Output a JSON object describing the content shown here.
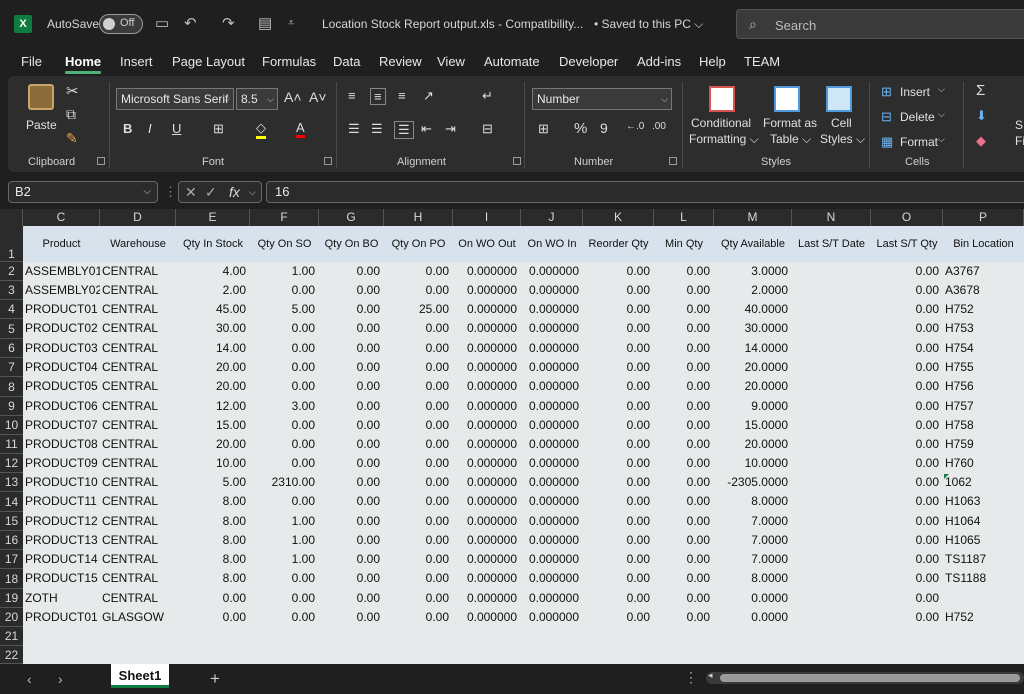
{
  "app": {
    "logo": "X",
    "autosave_label": "AutoSave",
    "autosave_state": "Off",
    "doc_title": "Location Stock Report output.xls  -  Compatibility...",
    "saved_status": "• Saved to this PC ⌵",
    "search_placeholder": "Search"
  },
  "menu": [
    "File",
    "Home",
    "Insert",
    "Page Layout",
    "Formulas",
    "Data",
    "Review",
    "View",
    "Automate",
    "Developer",
    "Add-ins",
    "Help",
    "TEAM"
  ],
  "ribbon": {
    "clipboard": {
      "label": "Clipboard",
      "paste": "Paste"
    },
    "font": {
      "label": "Font",
      "name": "Microsoft Sans Serif",
      "size": "8.5"
    },
    "alignment": {
      "label": "Alignment"
    },
    "number": {
      "label": "Number",
      "format": "Number"
    },
    "styles": {
      "label": "Styles",
      "conditional": "Conditional",
      "formatting": "Formatting ⌵",
      "format_as": "Format as",
      "table": "Table ⌵",
      "cell": "Cell",
      "styles_btn": "Styles ⌵"
    },
    "cells": {
      "label": "Cells",
      "insert": "Insert",
      "delete": "Delete",
      "format": "Format"
    },
    "editing": {
      "sort_s": "S",
      "fi": "Fi"
    }
  },
  "formula_bar": {
    "cell_ref": "B2",
    "value": "16"
  },
  "columns": [
    "C",
    "D",
    "E",
    "F",
    "G",
    "H",
    "I",
    "J",
    "K",
    "L",
    "M",
    "N",
    "O",
    "P"
  ],
  "headers": [
    "Product",
    "Warehouse",
    "Qty In Stock",
    "Qty On SO",
    "Qty On BO",
    "Qty On PO",
    "On WO Out",
    "On WO In",
    "Reorder Qty",
    "Min Qty",
    "Qty Available",
    "Last S/T Date",
    "Last S/T Qty",
    "Bin Location"
  ],
  "rows": [
    [
      "ASSEMBLY01",
      "CENTRAL",
      "4.00",
      "1.00",
      "0.00",
      "0.00",
      "0.000000",
      "0.000000",
      "0.00",
      "0.00",
      "3.0000",
      "",
      "0.00",
      "A3767"
    ],
    [
      "ASSEMBLY02",
      "CENTRAL",
      "2.00",
      "0.00",
      "0.00",
      "0.00",
      "0.000000",
      "0.000000",
      "0.00",
      "0.00",
      "2.0000",
      "",
      "0.00",
      "A3678"
    ],
    [
      "PRODUCT01",
      "CENTRAL",
      "45.00",
      "5.00",
      "0.00",
      "25.00",
      "0.000000",
      "0.000000",
      "0.00",
      "0.00",
      "40.0000",
      "",
      "0.00",
      "H752"
    ],
    [
      "PRODUCT02",
      "CENTRAL",
      "30.00",
      "0.00",
      "0.00",
      "0.00",
      "0.000000",
      "0.000000",
      "0.00",
      "0.00",
      "30.0000",
      "",
      "0.00",
      "H753"
    ],
    [
      "PRODUCT03",
      "CENTRAL",
      "14.00",
      "0.00",
      "0.00",
      "0.00",
      "0.000000",
      "0.000000",
      "0.00",
      "0.00",
      "14.0000",
      "",
      "0.00",
      "H754"
    ],
    [
      "PRODUCT04",
      "CENTRAL",
      "20.00",
      "0.00",
      "0.00",
      "0.00",
      "0.000000",
      "0.000000",
      "0.00",
      "0.00",
      "20.0000",
      "",
      "0.00",
      "H755"
    ],
    [
      "PRODUCT05",
      "CENTRAL",
      "20.00",
      "0.00",
      "0.00",
      "0.00",
      "0.000000",
      "0.000000",
      "0.00",
      "0.00",
      "20.0000",
      "",
      "0.00",
      "H756"
    ],
    [
      "PRODUCT06",
      "CENTRAL",
      "12.00",
      "3.00",
      "0.00",
      "0.00",
      "0.000000",
      "0.000000",
      "0.00",
      "0.00",
      "9.0000",
      "",
      "0.00",
      "H757"
    ],
    [
      "PRODUCT07",
      "CENTRAL",
      "15.00",
      "0.00",
      "0.00",
      "0.00",
      "0.000000",
      "0.000000",
      "0.00",
      "0.00",
      "15.0000",
      "",
      "0.00",
      "H758"
    ],
    [
      "PRODUCT08",
      "CENTRAL",
      "20.00",
      "0.00",
      "0.00",
      "0.00",
      "0.000000",
      "0.000000",
      "0.00",
      "0.00",
      "20.0000",
      "",
      "0.00",
      "H759"
    ],
    [
      "PRODUCT09",
      "CENTRAL",
      "10.00",
      "0.00",
      "0.00",
      "0.00",
      "0.000000",
      "0.000000",
      "0.00",
      "0.00",
      "10.0000",
      "",
      "0.00",
      "H760"
    ],
    [
      "PRODUCT10",
      "CENTRAL",
      "5.00",
      "2310.00",
      "0.00",
      "0.00",
      "0.000000",
      "0.000000",
      "0.00",
      "0.00",
      "-2305.0000",
      "",
      "0.00",
      "1062"
    ],
    [
      "PRODUCT11",
      "CENTRAL",
      "8.00",
      "0.00",
      "0.00",
      "0.00",
      "0.000000",
      "0.000000",
      "0.00",
      "0.00",
      "8.0000",
      "",
      "0.00",
      "H1063"
    ],
    [
      "PRODUCT12",
      "CENTRAL",
      "8.00",
      "1.00",
      "0.00",
      "0.00",
      "0.000000",
      "0.000000",
      "0.00",
      "0.00",
      "7.0000",
      "",
      "0.00",
      "H1064"
    ],
    [
      "PRODUCT13",
      "CENTRAL",
      "8.00",
      "1.00",
      "0.00",
      "0.00",
      "0.000000",
      "0.000000",
      "0.00",
      "0.00",
      "7.0000",
      "",
      "0.00",
      "H1065"
    ],
    [
      "PRODUCT14",
      "CENTRAL",
      "8.00",
      "1.00",
      "0.00",
      "0.00",
      "0.000000",
      "0.000000",
      "0.00",
      "0.00",
      "7.0000",
      "",
      "0.00",
      "TS1187"
    ],
    [
      "PRODUCT15",
      "CENTRAL",
      "8.00",
      "0.00",
      "0.00",
      "0.00",
      "0.000000",
      "0.000000",
      "0.00",
      "0.00",
      "8.0000",
      "",
      "0.00",
      "TS1188"
    ],
    [
      "ZOTH",
      "CENTRAL",
      "0.00",
      "0.00",
      "0.00",
      "0.00",
      "0.000000",
      "0.000000",
      "0.00",
      "0.00",
      "0.0000",
      "",
      "0.00",
      ""
    ],
    [
      "PRODUCT01",
      "GLASGOW",
      "0.00",
      "0.00",
      "0.00",
      "0.00",
      "0.000000",
      "0.000000",
      "0.00",
      "0.00",
      "0.0000",
      "",
      "0.00",
      "H752"
    ]
  ],
  "row_numbers": [
    "1",
    "2",
    "3",
    "4",
    "5",
    "6",
    "7",
    "8",
    "9",
    "10",
    "11",
    "12",
    "13",
    "14",
    "15",
    "16",
    "17",
    "18",
    "19",
    "20",
    "21",
    "22"
  ],
  "sheets": {
    "active": "Sheet1"
  },
  "colors": {
    "accent": "#107c41",
    "header_band": "#d7e2ec",
    "grid": "#e7eaea"
  }
}
